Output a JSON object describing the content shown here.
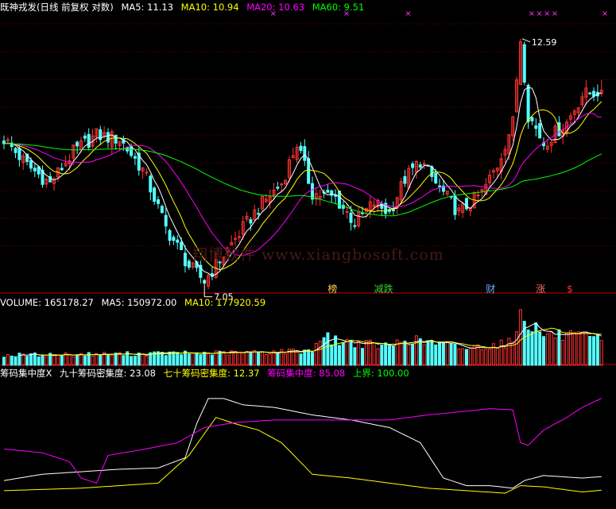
{
  "price_panel": {
    "title": "既神戎发(日线 前复权 对数)",
    "ma5": "MA5: 11.13",
    "ma10": "MA10: 10.94",
    "ma20": "MA20: 10.63",
    "ma60": "MA60: 9.51",
    "high_label": "12.59",
    "low_label": "7.05",
    "watermark": "翔博软件 www.xiangbosoft.com",
    "markers": [
      {
        "text": "榜",
        "color": "#ffd24a",
        "day": 84
      },
      {
        "text": "减跌",
        "color": "#32d232",
        "day": 96
      },
      {
        "text": "财",
        "color": "#6fa8ff",
        "day": 125
      },
      {
        "text": "涨",
        "color": "#ff6a6a",
        "day": 138
      },
      {
        "text": "$",
        "color": "#ff3030",
        "day": 146
      }
    ],
    "crosses": [
      {
        "day": 69
      },
      {
        "day": 88
      },
      {
        "day": 104
      },
      {
        "day": 136
      },
      {
        "day": 138
      },
      {
        "day": 140
      },
      {
        "day": 142
      },
      {
        "day": 155
      },
      {
        "day": 159
      }
    ]
  },
  "volume_panel": {
    "volume": "VOLUME: 165178.27",
    "ma5": "MA5: 150972.00",
    "ma10": "MA10: 177920.59"
  },
  "chip_panel": {
    "label_x": "筹码集中度X",
    "label_90": "九十筹码密集度: 23.08",
    "label_70": "七十筹码密集度: 12.37",
    "label_conc": "筹码集中度: 85.08",
    "label_upper": "上界: 100.00"
  },
  "colors": {
    "up": "#ff3232",
    "down": "#54ffff",
    "ma5": "#ffffff",
    "ma10": "#ffff00",
    "ma20": "#ff00ff",
    "ma60": "#00ff00",
    "grid": "#7a0000",
    "frame": "#c00000"
  },
  "chart_data": [
    {
      "type": "candlestick",
      "title": "既神戎发(日线 前复权 对数)",
      "y_range": [
        6.9,
        13.4
      ],
      "scale": "log",
      "annotations": [
        "12.59",
        "7.05"
      ],
      "waypoints": [
        [
          0,
          9.9
        ],
        [
          6,
          9.3
        ],
        [
          12,
          8.9
        ],
        [
          18,
          9.6
        ],
        [
          24,
          10.0
        ],
        [
          30,
          9.9
        ],
        [
          36,
          9.2
        ],
        [
          42,
          8.0
        ],
        [
          48,
          7.3
        ],
        [
          52,
          7.05
        ],
        [
          58,
          7.6
        ],
        [
          66,
          8.4
        ],
        [
          72,
          8.9
        ],
        [
          76,
          9.8
        ],
        [
          80,
          8.7
        ],
        [
          86,
          8.6
        ],
        [
          91,
          8.1
        ],
        [
          96,
          8.5
        ],
        [
          100,
          8.3
        ],
        [
          104,
          9.0
        ],
        [
          108,
          9.4
        ],
        [
          112,
          8.9
        ],
        [
          118,
          8.3
        ],
        [
          124,
          8.7
        ],
        [
          128,
          9.3
        ],
        [
          132,
          10.3
        ],
        [
          134,
          12.59
        ],
        [
          136,
          10.5
        ],
        [
          140,
          9.8
        ],
        [
          146,
          10.3
        ],
        [
          150,
          11.0
        ],
        [
          155,
          11.13
        ]
      ],
      "series": [
        {
          "name": "MA5",
          "value": 11.13
        },
        {
          "name": "MA10",
          "value": 10.94
        },
        {
          "name": "MA20",
          "value": 10.63
        },
        {
          "name": "MA60",
          "value": 9.51
        }
      ]
    },
    {
      "type": "bar",
      "title": "VOLUME",
      "y_range": [
        0,
        380000
      ],
      "waypoints": [
        [
          0,
          65000
        ],
        [
          20,
          70000
        ],
        [
          40,
          75000
        ],
        [
          60,
          80000
        ],
        [
          80,
          95000
        ],
        [
          82,
          190000
        ],
        [
          86,
          160000
        ],
        [
          100,
          120000
        ],
        [
          104,
          170000
        ],
        [
          120,
          110000
        ],
        [
          132,
          150000
        ],
        [
          134,
          370000
        ],
        [
          136,
          280000
        ],
        [
          140,
          200000
        ],
        [
          146,
          190000
        ],
        [
          155,
          165178
        ]
      ],
      "series": [
        {
          "name": "VOLUME",
          "value": 165178.27
        },
        {
          "name": "MA5",
          "value": 150972.0
        },
        {
          "name": "MA10",
          "value": 177920.59
        }
      ]
    },
    {
      "type": "line",
      "title": "筹码集中度X",
      "y_range": [
        0,
        100
      ],
      "series": [
        {
          "name": "九十筹码密集度",
          "value": 23.08,
          "waypoints": [
            [
              0,
              20
            ],
            [
              10,
              25
            ],
            [
              20,
              27
            ],
            [
              30,
              29
            ],
            [
              40,
              30
            ],
            [
              47,
              38
            ],
            [
              50,
              65
            ],
            [
              53,
              85
            ],
            [
              57,
              85
            ],
            [
              62,
              80
            ],
            [
              70,
              78
            ],
            [
              80,
              72
            ],
            [
              90,
              68
            ],
            [
              100,
              62
            ],
            [
              108,
              50
            ],
            [
              114,
              22
            ],
            [
              120,
              16
            ],
            [
              126,
              16
            ],
            [
              132,
              14
            ],
            [
              135,
              20
            ],
            [
              140,
              24
            ],
            [
              150,
              22
            ],
            [
              155,
              23.08
            ]
          ]
        },
        {
          "name": "七十筹码密集度",
          "value": 12.37,
          "waypoints": [
            [
              0,
              12
            ],
            [
              20,
              14
            ],
            [
              30,
              16
            ],
            [
              40,
              18
            ],
            [
              48,
              40
            ],
            [
              55,
              70
            ],
            [
              60,
              65
            ],
            [
              66,
              60
            ],
            [
              72,
              50
            ],
            [
              80,
              25
            ],
            [
              90,
              22
            ],
            [
              100,
              18
            ],
            [
              110,
              14
            ],
            [
              120,
              12
            ],
            [
              130,
              10
            ],
            [
              134,
              16
            ],
            [
              140,
              15
            ],
            [
              150,
              11
            ],
            [
              155,
              12.37
            ]
          ]
        },
        {
          "name": "筹码集中度",
          "value": 85.08,
          "waypoints": [
            [
              0,
              45
            ],
            [
              10,
              42
            ],
            [
              17,
              35
            ],
            [
              20,
              22
            ],
            [
              24,
              18
            ],
            [
              27,
              40
            ],
            [
              35,
              44
            ],
            [
              45,
              50
            ],
            [
              52,
              62
            ],
            [
              60,
              66
            ],
            [
              70,
              68
            ],
            [
              80,
              68
            ],
            [
              90,
              68
            ],
            [
              100,
              68
            ],
            [
              110,
              72
            ],
            [
              120,
              75
            ],
            [
              126,
              77
            ],
            [
              132,
              76
            ],
            [
              134,
              50
            ],
            [
              136,
              48
            ],
            [
              140,
              60
            ],
            [
              146,
              70
            ],
            [
              150,
              78
            ],
            [
              155,
              85.08
            ]
          ]
        },
        {
          "name": "上界",
          "value": 100.0
        }
      ]
    }
  ]
}
